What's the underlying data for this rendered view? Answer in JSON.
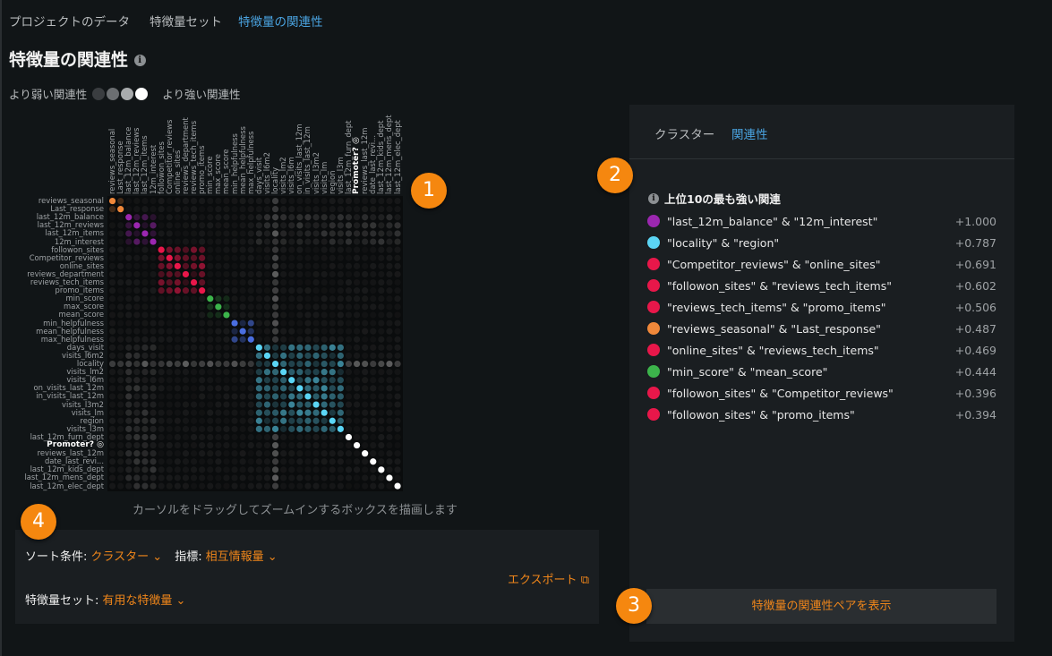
{
  "breadcrumbs": [
    "プロジェクトのデータ",
    "特徴量セット",
    "特徴量の関連性"
  ],
  "title": "特徴量の関連性",
  "legend": {
    "weaker": "より弱い関連性",
    "stronger": "より強い関連性",
    "swatches": [
      "#3a3d40",
      "#6c6f72",
      "#a8abad",
      "#ffffff"
    ]
  },
  "matrix": {
    "features": [
      "reviews_seasonal",
      "Last_response",
      "last_12m_balance",
      "last_12m_reviews",
      "last_12m_items",
      "12m_interest",
      "followon_sites",
      "Competitor_reviews",
      "online_sites",
      "reviews_department",
      "reviews_tech_items",
      "promo_items",
      "min_score",
      "max_score",
      "mean_score",
      "min_helpfulness",
      "mean_helpfulness",
      "max_helpfulness",
      "days_visit",
      "visits_l6m2",
      "locality",
      "visits_lm2",
      "visits_l6m",
      "on_visits_last_12m",
      "in_visits_last_12m",
      "visits_l3m2",
      "visits_lm",
      "region",
      "visits_l3m",
      "last_12m_furn_dept",
      "Promoter? ◎",
      "reviews_last_12m",
      "date_last_revi...",
      "last_12m_kids_dept",
      "last_12m_mens_dept",
      "last_12m_elec_dept"
    ],
    "target_index": 30,
    "clusters": [
      {
        "start": 0,
        "end": 1,
        "color": "#f0883a"
      },
      {
        "start": 2,
        "end": 5,
        "color": "#9b27b0"
      },
      {
        "start": 6,
        "end": 11,
        "color": "#e8174a"
      },
      {
        "start": 12,
        "end": 14,
        "color": "#3cb44b"
      },
      {
        "start": 15,
        "end": 17,
        "color": "#4a6ee0"
      },
      {
        "start": 18,
        "end": 28,
        "color": "#5bd5f5"
      }
    ],
    "hint": "カーソルをドラッグしてズームインするボックスを描画します"
  },
  "controls": {
    "sort_label": "ソート条件:",
    "sort_value": "クラスター",
    "metric_label": "指標:",
    "metric_value": "相互情報量",
    "featureset_label": "特徴量セット:",
    "featureset_value": "有用な特徴量",
    "export": "エクスポート"
  },
  "panel": {
    "tabs": [
      "クラスター",
      "関連性"
    ],
    "heading": "上位10の最も強い関連",
    "pairs": [
      {
        "text": "\"last_12m_balance\" & \"12m_interest\"",
        "value": "+1.000",
        "color": "#9b27b0"
      },
      {
        "text": "\"locality\" & \"region\"",
        "value": "+0.787",
        "color": "#5bd5f5"
      },
      {
        "text": "\"Competitor_reviews\" & \"online_sites\"",
        "value": "+0.691",
        "color": "#e8174a"
      },
      {
        "text": "\"followon_sites\" & \"reviews_tech_items\"",
        "value": "+0.602",
        "color": "#e8174a"
      },
      {
        "text": "\"reviews_tech_items\" & \"promo_items\"",
        "value": "+0.506",
        "color": "#e8174a"
      },
      {
        "text": "\"reviews_seasonal\" & \"Last_response\"",
        "value": "+0.487",
        "color": "#f0883a"
      },
      {
        "text": "\"online_sites\" & \"reviews_tech_items\"",
        "value": "+0.469",
        "color": "#e8174a"
      },
      {
        "text": "\"min_score\" & \"mean_score\"",
        "value": "+0.444",
        "color": "#3cb44b"
      },
      {
        "text": "\"followon_sites\" & \"Competitor_reviews\"",
        "value": "+0.396",
        "color": "#e8174a"
      },
      {
        "text": "\"followon_sites\" & \"promo_items\"",
        "value": "+0.394",
        "color": "#e8174a"
      }
    ],
    "button": "特徴量の関連性ペアを表示"
  },
  "badges": [
    "1",
    "2",
    "3",
    "4"
  ]
}
